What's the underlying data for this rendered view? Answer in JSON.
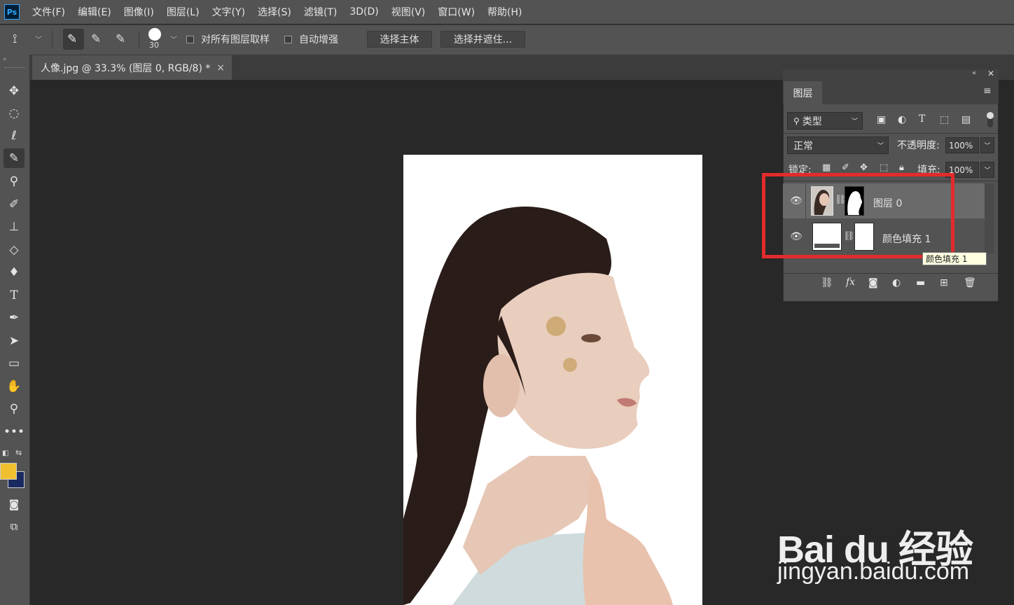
{
  "app": {
    "logo": "Ps"
  },
  "menu": [
    "文件(F)",
    "编辑(E)",
    "图像(I)",
    "图层(L)",
    "文字(Y)",
    "选择(S)",
    "滤镜(T)",
    "3D(D)",
    "视图(V)",
    "窗口(W)",
    "帮助(H)"
  ],
  "options": {
    "brush_size": "30",
    "sample_all_label": "对所有图层取样",
    "auto_enhance_label": "自动增强",
    "select_subject": "选择主体",
    "select_and_mask": "选择并遮住..."
  },
  "document_tab": {
    "title": "人像.jpg @ 33.3% (图层 0, RGB/8) *",
    "close": "×"
  },
  "colors": {
    "foreground": "#f0c030",
    "background": "#1a2a60",
    "highlight": "#e32b2b"
  },
  "layers_panel": {
    "tab": "图层",
    "filter_kind": "类型",
    "blend_mode": "正常",
    "opacity_label": "不透明度:",
    "opacity_value": "100%",
    "lock_label": "锁定:",
    "fill_label": "填充:",
    "fill_value": "100%",
    "layers": [
      {
        "name": "图层 0",
        "visible": true,
        "selected": true
      },
      {
        "name": "颜色填充 1",
        "visible": true,
        "selected": false
      }
    ],
    "tooltip": "颜色填充 1"
  },
  "watermark": {
    "logo": "Bai du 经验",
    "url": "jingyan.baidu.com"
  }
}
